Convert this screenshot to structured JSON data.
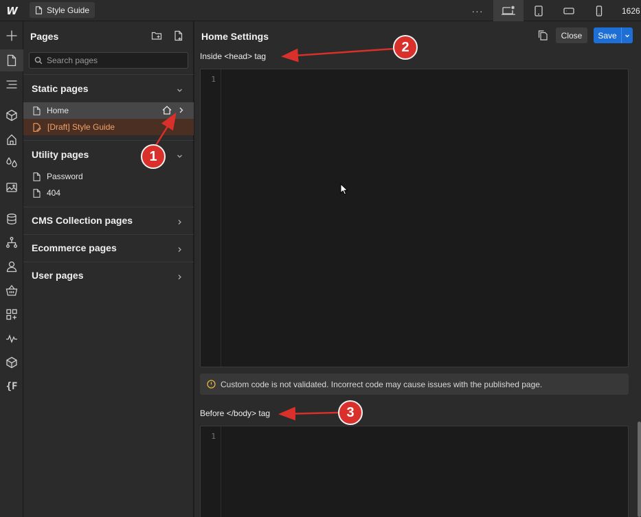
{
  "topbar": {
    "logo_letter": "W",
    "page_pill": "Style Guide",
    "more_label": "···",
    "canvas_width": "1626"
  },
  "rail": {
    "items": [
      "add-icon",
      "pages-icon",
      "navigator-icon",
      "components-icon",
      "style-selectors-icon",
      "variables-icon",
      "assets-icon",
      "cms-icon",
      "logic-icon",
      "users-icon",
      "ecommerce-icon",
      "apps-icon",
      "audit-icon",
      "3d-icon"
    ],
    "code_label": "{F"
  },
  "pages": {
    "title": "Pages",
    "search": {
      "placeholder": "Search pages",
      "value": ""
    },
    "static": {
      "label": "Static pages",
      "items": [
        {
          "label": "Home"
        },
        {
          "label": "[Draft] Style Guide"
        }
      ]
    },
    "utility": {
      "label": "Utility pages",
      "items": [
        {
          "label": "Password"
        },
        {
          "label": "404"
        }
      ]
    },
    "cms": {
      "label": "CMS Collection pages"
    },
    "ecommerce": {
      "label": "Ecommerce pages"
    },
    "user": {
      "label": "User pages"
    }
  },
  "settings": {
    "title": "Home Settings",
    "close_label": "Close",
    "save_label": "Save",
    "head_label": "Inside <head> tag",
    "head_line_no": "1",
    "notice": "Custom code is not validated. Incorrect code may cause issues with the published page.",
    "body_label": "Before </body> tag",
    "body_line_no": "1"
  },
  "annotations": {
    "badge_1": "1",
    "badge_2": "2",
    "badge_3": "3",
    "color": "#d9302b"
  },
  "colors": {
    "accent": "#1d6fd6",
    "draft": "#f2a36b",
    "background": "#2b2b2b",
    "editor": "#1b1b1b",
    "warning": "#e3b341"
  }
}
